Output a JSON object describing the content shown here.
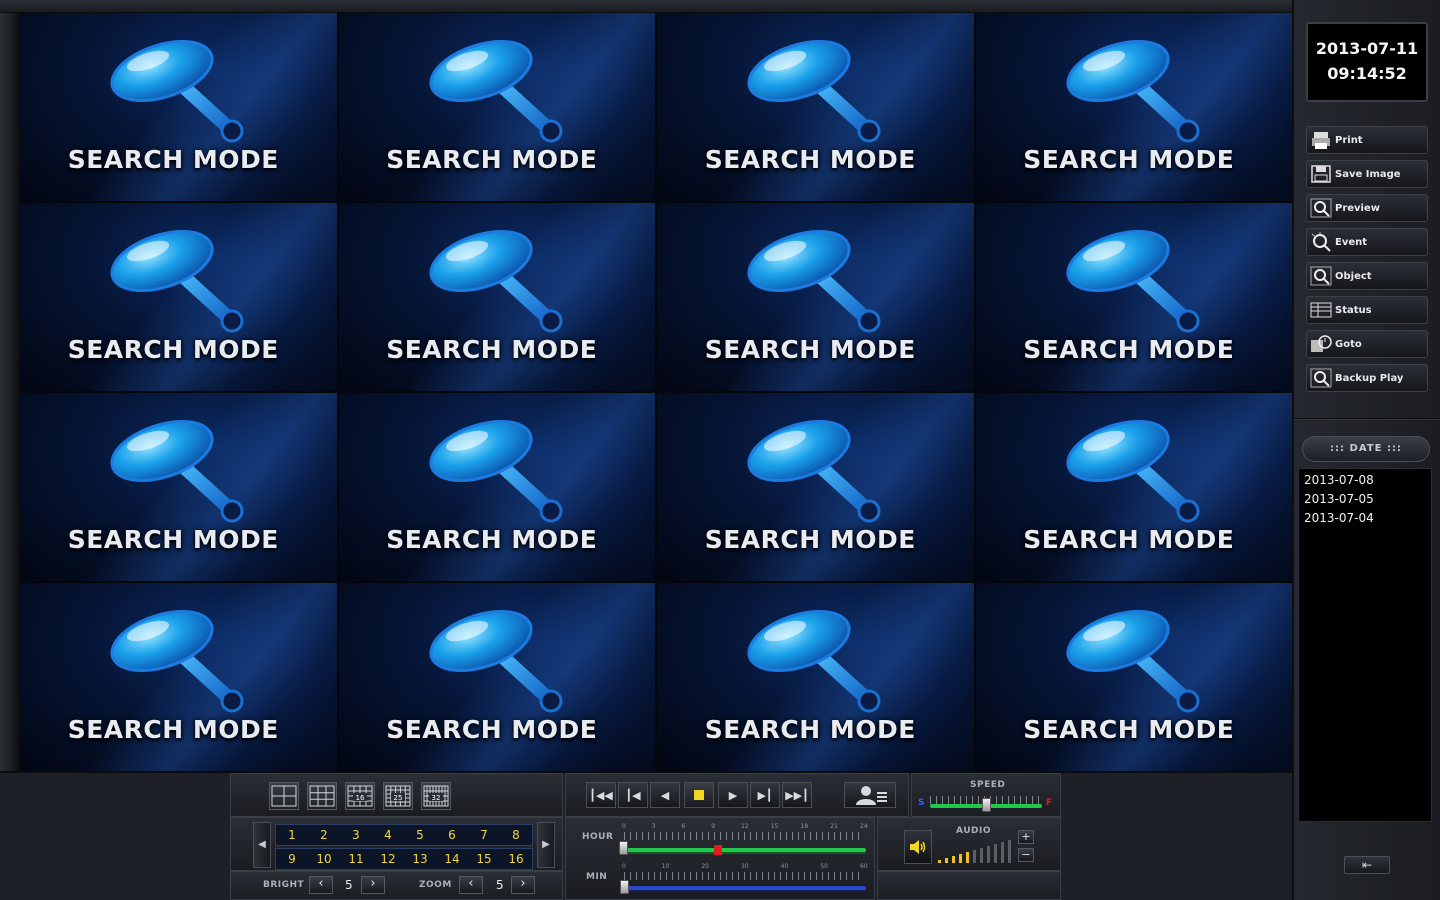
{
  "clock": {
    "date": "2013-07-11",
    "time": "09:14:52"
  },
  "tiles": [
    "SEARCH MODE",
    "SEARCH MODE",
    "SEARCH MODE",
    "SEARCH MODE",
    "SEARCH MODE",
    "SEARCH MODE",
    "SEARCH MODE",
    "SEARCH MODE",
    "SEARCH MODE",
    "SEARCH MODE",
    "SEARCH MODE",
    "SEARCH MODE",
    "SEARCH MODE",
    "SEARCH MODE",
    "SEARCH MODE",
    "SEARCH MODE"
  ],
  "side_menu": [
    {
      "label": "Print",
      "icon": "printer-icon"
    },
    {
      "label": "Save Image",
      "icon": "floppy-disk-icon"
    },
    {
      "label": "Preview",
      "icon": "preview-magnifier-icon"
    },
    {
      "label": "Event",
      "icon": "event-magnifier-icon"
    },
    {
      "label": "Object",
      "icon": "object-magnifier-icon"
    },
    {
      "label": "Status",
      "icon": "status-grid-icon"
    },
    {
      "label": "Goto",
      "icon": "goto-clock-icon"
    },
    {
      "label": "Backup Play",
      "icon": "backup-play-icon"
    }
  ],
  "date_panel": {
    "header": "::: DATE :::",
    "dates": [
      "2013-07-08",
      "2013-07-05",
      "2013-07-04"
    ]
  },
  "exit_icon": "exit-arrow-icon",
  "layout_buttons": [
    "4",
    "9",
    "16",
    "25",
    "32"
  ],
  "channels_row1": [
    "1",
    "2",
    "3",
    "4",
    "5",
    "6",
    "7",
    "8"
  ],
  "channels_row2": [
    "9",
    "10",
    "11",
    "12",
    "13",
    "14",
    "15",
    "16"
  ],
  "bright": {
    "label": "BRIGHT",
    "value": "5"
  },
  "zoom": {
    "label": "ZOOM",
    "value": "5"
  },
  "playback_buttons": [
    "skip-to-start-icon",
    "step-back-icon",
    "reverse-play-icon",
    "stop-icon",
    "play-icon",
    "step-forward-icon",
    "skip-to-end-icon"
  ],
  "speed": {
    "label": "SPEED",
    "low": "S",
    "high": "F",
    "level": 0.5
  },
  "hour_slider": {
    "label": "HOUR",
    "ticks": [
      "0",
      "3",
      "6",
      "9",
      "12",
      "15",
      "18",
      "21",
      "24"
    ],
    "value": 9.4
  },
  "min_slider": {
    "label": "MIN",
    "ticks": [
      "0",
      "10",
      "20",
      "30",
      "40",
      "50",
      "60"
    ],
    "value": 0
  },
  "audio": {
    "label": "AUDIO",
    "plus": "+",
    "minus": "−",
    "icon": "speaker-icon"
  },
  "colors": {
    "accent_yellow": "#f2d53c",
    "timeline_green": "#21c94a",
    "timeline_blue": "#2a49c9",
    "cursor_red": "#e21b1b"
  }
}
